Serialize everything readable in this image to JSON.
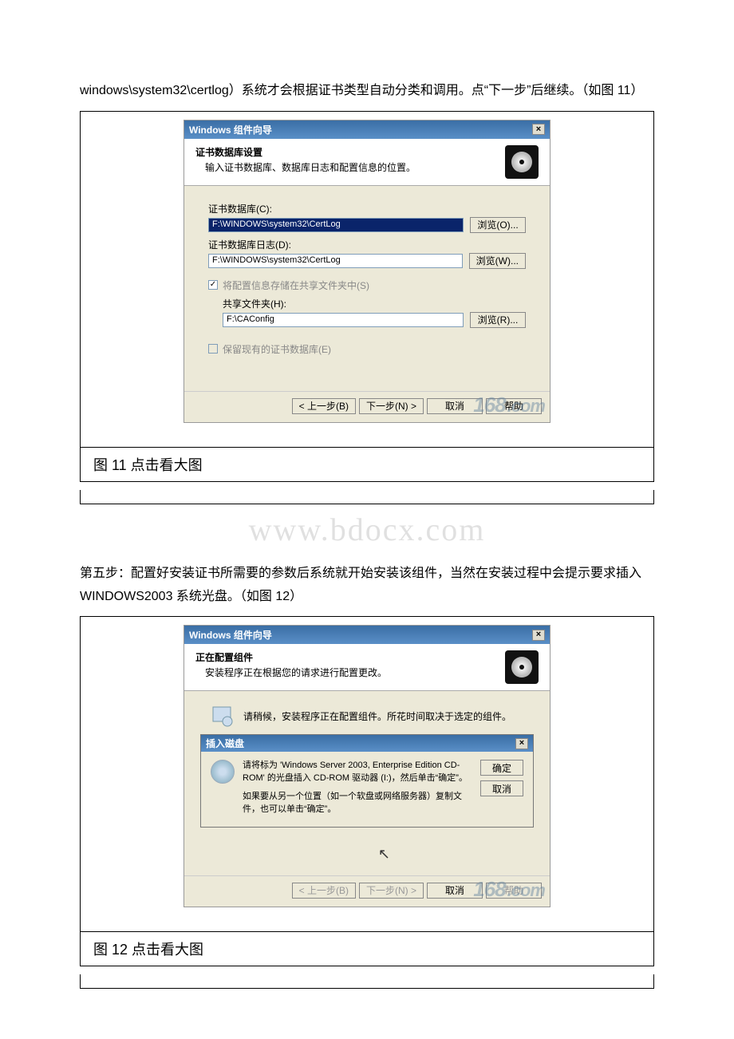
{
  "intro_para": "windows\\system32\\certlog）系统才会根据证书类型自动分类和调用。点“下一步”后继续。（如图 11）",
  "watermark_site": "www.bdocx.com",
  "step5_para": "第五步：配置好安装证书所需要的参数后系统就开始安装该组件，当然在安装过程中会提示要求插入 WINDOWS2003 系统光盘。（如图 12）",
  "win1": {
    "title": "Windows 组件向导",
    "header_title": "证书数据库设置",
    "header_sub": "输入证书数据库、数据库日志和配置信息的位置。",
    "label_db": "证书数据库(C):",
    "value_db": "F:\\WINDOWS\\system32\\CertLog",
    "btn_browse_db": "浏览(O)...",
    "label_log": "证书数据库日志(D):",
    "value_log": "F:\\WINDOWS\\system32\\CertLog",
    "btn_browse_log": "浏览(W)...",
    "check_shared": "将配置信息存储在共享文件夹中(S)",
    "label_share": "共享文件夹(H):",
    "value_share": "F:\\CAConfig",
    "btn_browse_share": "浏览(R)...",
    "check_keep": "保留现有的证书数据库(E)",
    "btn_back": "< 上一步(B)",
    "btn_next": "下一步(N) >",
    "btn_cancel": "取消",
    "btn_help": "帮助",
    "wm_num": "168",
    "wm_suffix": ".com"
  },
  "caption1": "图 11 点击看大图",
  "win2": {
    "title": "Windows 组件向导",
    "header_title": "正在配置组件",
    "header_sub": "安装程序正在根据您的请求进行配置更改。",
    "wait_text": "请稍候，安装程序正在配置组件。所花时间取决于选定的组件。",
    "popup_title": "插入磁盘",
    "popup_text1": "请将标为 'Windows Server 2003, Enterprise Edition CD-ROM' 的光盘插入 CD-ROM 驱动器 (I:)，然后单击“确定”。",
    "popup_text2": "如果要从另一个位置（如一个软盘或网络服务器）复制文件，也可以单击“确定”。",
    "btn_ok": "确定",
    "btn_cancel_popup": "取消",
    "btn_back": "< 上一步(B)",
    "btn_next": "下一步(N) >",
    "btn_cancel": "取消",
    "btn_help": "帮助",
    "wm_num": "168",
    "wm_suffix": ".com"
  },
  "caption2": "图 12 点击看大图"
}
